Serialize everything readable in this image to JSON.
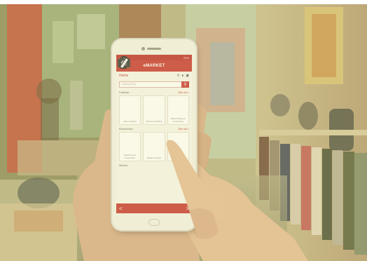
{
  "phone": {
    "status_left": "••ll Wi",
    "status_right": "24%",
    "app_title": "eMARKET",
    "home_label": "Home",
    "search_placeholder": "Catalog Items",
    "sections": [
      {
        "title": "Fashion",
        "see_all": "See all >",
        "items": [
          {
            "caption": "Men's Clothing",
            "icon": "tshirt-icon"
          },
          {
            "caption": "Women's Clothing",
            "icon": "high-heel-icon"
          },
          {
            "caption": "Baby Clothing & Accessories",
            "icon": "baby-clothes-icon"
          }
        ]
      },
      {
        "title": "Electronics",
        "see_all": "See all >",
        "items": [
          {
            "caption": "Cell Phones & Accessories",
            "icon": "smartphone-icon"
          },
          {
            "caption": "Digital Cameras",
            "icon": "camera-icon"
          },
          {
            "caption": "Video Games & Consoles",
            "icon": "tablet-icon"
          }
        ]
      },
      {
        "title": "Motors",
        "see_all": "See all >"
      }
    ],
    "nav_prev": "<",
    "nav_next": ">",
    "accent_color": "#c8403e"
  }
}
